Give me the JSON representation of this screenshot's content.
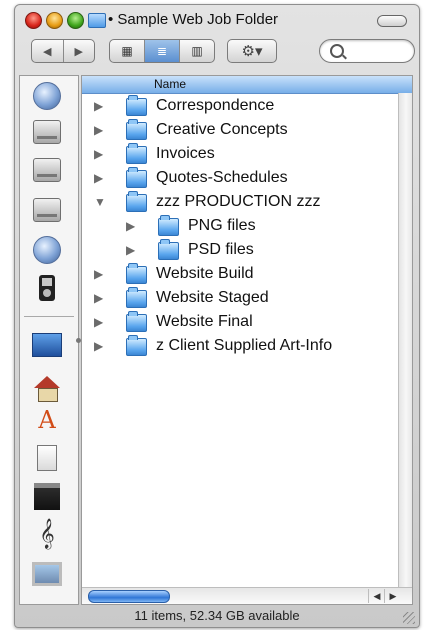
{
  "window": {
    "title": "• Sample Web Job Folder"
  },
  "toolbar": {
    "back_glyph": "◀",
    "forward_glyph": "▶",
    "view_icon_glyph": "▦",
    "view_list_glyph": "≣",
    "view_column_glyph": "▥",
    "action_glyph": "⚙▾",
    "search_placeholder": "",
    "active_view": "list"
  },
  "sidebar": {
    "items": [
      {
        "icon": "network-globe-icon"
      },
      {
        "icon": "hard-drive-icon"
      },
      {
        "icon": "hard-drive-icon"
      },
      {
        "icon": "hard-drive-icon"
      },
      {
        "icon": "globe-icon"
      },
      {
        "icon": "ipod-icon"
      },
      {
        "icon": "desktop-icon"
      },
      {
        "icon": "home-icon"
      },
      {
        "icon": "applications-icon"
      },
      {
        "icon": "documents-icon"
      },
      {
        "icon": "movies-icon"
      },
      {
        "icon": "music-icon"
      },
      {
        "icon": "pictures-icon"
      }
    ],
    "glyphs": {
      "apps": "A",
      "music": "𝄞"
    }
  },
  "list": {
    "column_header": "Name",
    "collapsed_glyph": "▶",
    "expanded_glyph": "▼",
    "rows": [
      {
        "label": "Correspondence",
        "expanded": false,
        "level": 0
      },
      {
        "label": "Creative Concepts",
        "expanded": false,
        "level": 0
      },
      {
        "label": "Invoices",
        "expanded": false,
        "level": 0
      },
      {
        "label": "Quotes-Schedules",
        "expanded": false,
        "level": 0
      },
      {
        "label": "zzz PRODUCTION zzz",
        "expanded": true,
        "level": 0
      },
      {
        "label": "PNG files",
        "expanded": false,
        "level": 1
      },
      {
        "label": "PSD files",
        "expanded": false,
        "level": 1
      },
      {
        "label": "Website  Build",
        "expanded": false,
        "level": 0
      },
      {
        "label": "Website  Staged",
        "expanded": false,
        "level": 0
      },
      {
        "label": "Website Final",
        "expanded": false,
        "level": 0
      },
      {
        "label": "z Client Supplied Art-Info",
        "expanded": false,
        "level": 0
      }
    ]
  },
  "scroll": {
    "left_glyph": "◀",
    "right_glyph": "▶"
  },
  "status": {
    "text": "11 items, 52.34 GB available"
  }
}
